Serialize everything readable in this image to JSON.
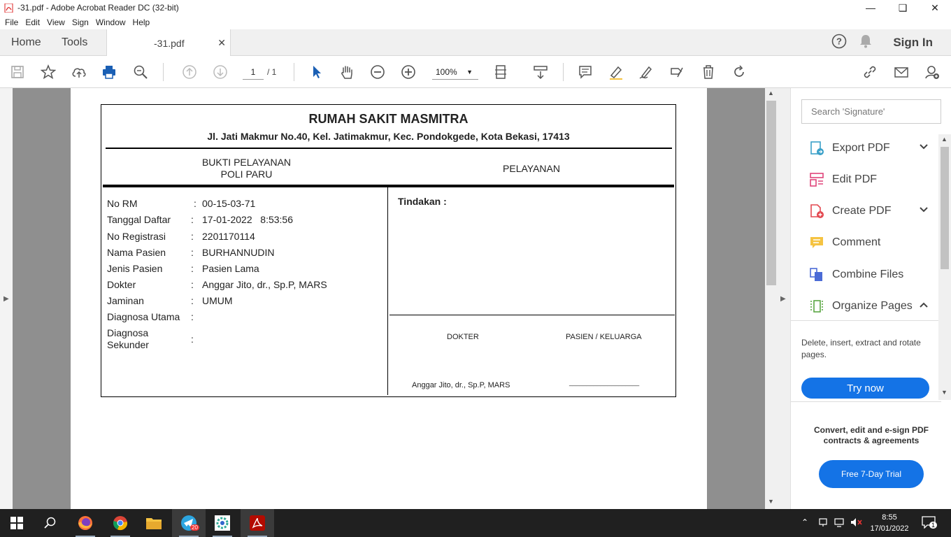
{
  "window": {
    "title": "-31.pdf - Adobe Acrobat Reader DC (32-bit)"
  },
  "menu": [
    "File",
    "Edit",
    "View",
    "Sign",
    "Window",
    "Help"
  ],
  "tabs": {
    "home": "Home",
    "tools": "Tools",
    "document": "-31.pdf",
    "sign_in": "Sign In"
  },
  "toolbar": {
    "page_current": "1",
    "page_total": "/ 1",
    "zoom": "100%"
  },
  "document": {
    "hospital": "RUMAH SAKIT MASMITRA",
    "address": "Jl. Jati Makmur No.40, Kel. Jatimakmur, Kec. Pondokgede, Kota Bekasi, 17413",
    "receipt_line1": "BUKTI PELAYANAN",
    "receipt_line2": "POLI PARU",
    "service_header": "PELAYANAN",
    "fields": [
      {
        "label": "No RM",
        "value": "00-15-03-71"
      },
      {
        "label": "Tanggal Daftar",
        "value": "17-01-2022   8:53:56"
      },
      {
        "label": "No Registrasi",
        "value": "2201170114"
      },
      {
        "label": "Nama Pasien",
        "value": "BURHANNUDIN"
      },
      {
        "label": "Jenis Pasien",
        "value": "Pasien Lama"
      },
      {
        "label": "Dokter",
        "value": "Anggar Jito, dr., Sp.P, MARS"
      },
      {
        "label": "Jaminan",
        "value": "UMUM"
      },
      {
        "label": "Diagnosa Utama",
        "value": ""
      },
      {
        "label": "Diagnosa Sekunder",
        "value": ""
      }
    ],
    "tindakan": "Tindakan :",
    "doctor_header": "DOKTER",
    "patient_header": "PASIEN / KELUARGA",
    "doctor_sign": "Anggar Jito, dr., Sp.P, MARS",
    "patient_sign": "____________________"
  },
  "right_pane": {
    "search_placeholder": "Search 'Signature'",
    "tools": [
      {
        "label": "Export PDF",
        "icon": "export-pdf-icon",
        "color": "#3aa0c8"
      },
      {
        "label": "Edit PDF",
        "icon": "edit-pdf-icon",
        "color": "#e0457b"
      },
      {
        "label": "Create PDF",
        "icon": "create-pdf-icon",
        "color": "#e34850"
      },
      {
        "label": "Comment",
        "icon": "comment-icon",
        "color": "#f5c342"
      },
      {
        "label": "Combine Files",
        "icon": "combine-files-icon",
        "color": "#4b6bd6"
      },
      {
        "label": "Organize Pages",
        "icon": "organize-pages-icon",
        "color": "#5aa643"
      }
    ],
    "organize_desc": "Delete, insert, extract and rotate pages.",
    "try_now": "Try now",
    "promo": "Convert, edit and e-sign PDF contracts & agreements",
    "trial": "Free 7-Day Trial"
  },
  "taskbar": {
    "time": "8:55",
    "date": "17/01/2022",
    "telegram_badge": "20",
    "notification_count": "1"
  }
}
